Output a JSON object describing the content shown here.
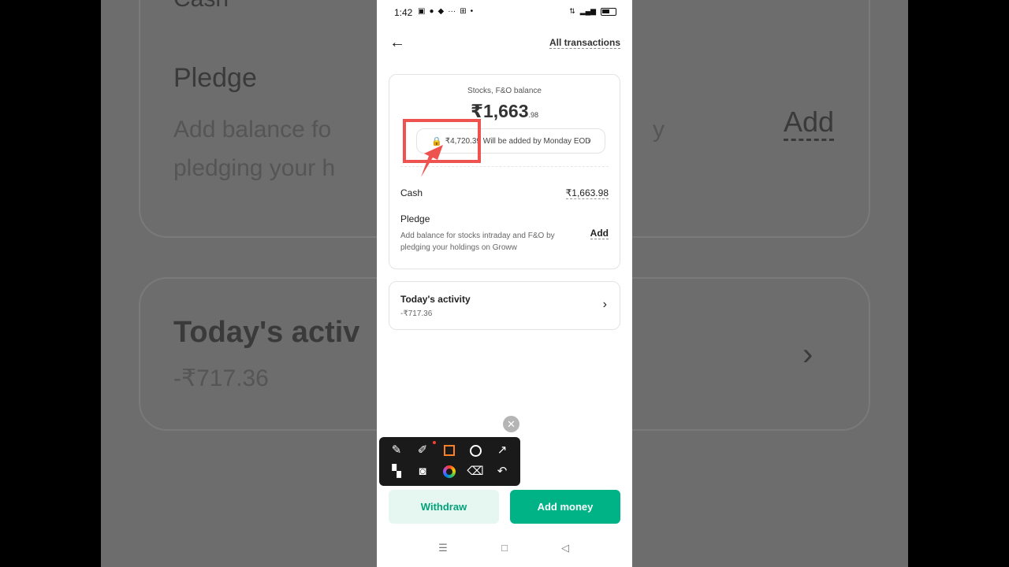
{
  "background": {
    "cash_label": "Cash",
    "pledge_label": "Pledge",
    "pledge_desc_1": "Add balance fo",
    "pledge_desc_2": "pledging your h",
    "pledge_desc_right": "y",
    "add_label": "Add",
    "activity_label": "Today's activ",
    "activity_value": "-₹717.36"
  },
  "status_bar": {
    "time": "1:42",
    "left_icons": [
      "chat-icon",
      "snapchat-icon",
      "message-icon",
      "more-dots-icon",
      "app-icon",
      "dot-icon"
    ],
    "right_icons": [
      "volte-icon",
      "signal-icon",
      "battery-icon"
    ]
  },
  "header": {
    "back_icon": "arrow-left-icon",
    "all_transactions_label": "All transactions"
  },
  "balance_card": {
    "label": "Stocks, F&O balance",
    "amount_main": "₹1,663",
    "amount_decimal": ".98",
    "pending_text": "₹4,720.39 Will be added by Monday EOD",
    "cash_label": "Cash",
    "cash_value": "₹1,663.98",
    "pledge_label": "Pledge",
    "pledge_desc": "Add balance for stocks intraday and F&O by pledging your holdings on Groww",
    "pledge_add_label": "Add"
  },
  "activity_card": {
    "title": "Today's activity",
    "value": "-₹717.36"
  },
  "annotation_toolbar": {
    "tools": [
      "brush-icon",
      "highlighter-icon",
      "rectangle-icon",
      "circle-icon",
      "arrow-icon",
      "mosaic-icon",
      "camera-icon",
      "color-picker-icon",
      "eraser-icon",
      "undo-icon"
    ],
    "colors": {
      "rectangle": "#ff7f27",
      "annotation": "#ef5350"
    }
  },
  "actions": {
    "withdraw_label": "Withdraw",
    "add_money_label": "Add money"
  },
  "colors": {
    "brand_green": "#00b386",
    "withdraw_bg": "#e6f6f1",
    "withdraw_text": "#00a37a"
  }
}
